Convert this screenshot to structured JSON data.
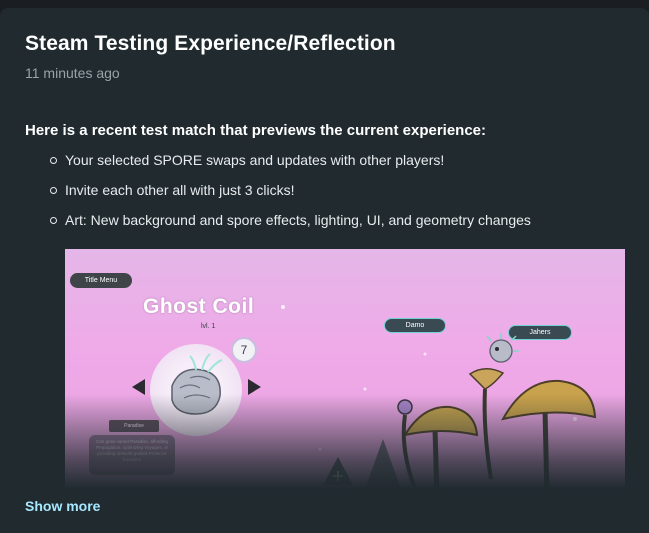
{
  "post": {
    "title": "Steam Testing Experience/Reflection",
    "timestamp": "11 minutes ago",
    "intro": "Here is a recent test match that previews the current experience:",
    "bullets": [
      "Your selected SPORE swaps and updates with other players!",
      "Invite each other all with just 3 clicks!",
      "Art: New background and spore effects, lighting, UI, and geometry changes"
    ],
    "show_more": "Show more"
  },
  "game_screenshot": {
    "title_menu": "Title Menu",
    "spore_name": "Ghost Coil",
    "level": "lvl. 1",
    "count_badge": "7",
    "player_tags": [
      "Damo",
      "Jahers"
    ],
    "paradise_label": "Paradise",
    "description": "Can grow varied Paradise, affording Propagation, optimizing Voyages, or providing network-guided Protector functions"
  },
  "colors": {
    "page_bg": "#1a1e22",
    "card_bg": "#202a2f",
    "link": "#a6e8ff",
    "sky_pink": "#f0a9e8",
    "tag_border": "#6fd3d6"
  }
}
